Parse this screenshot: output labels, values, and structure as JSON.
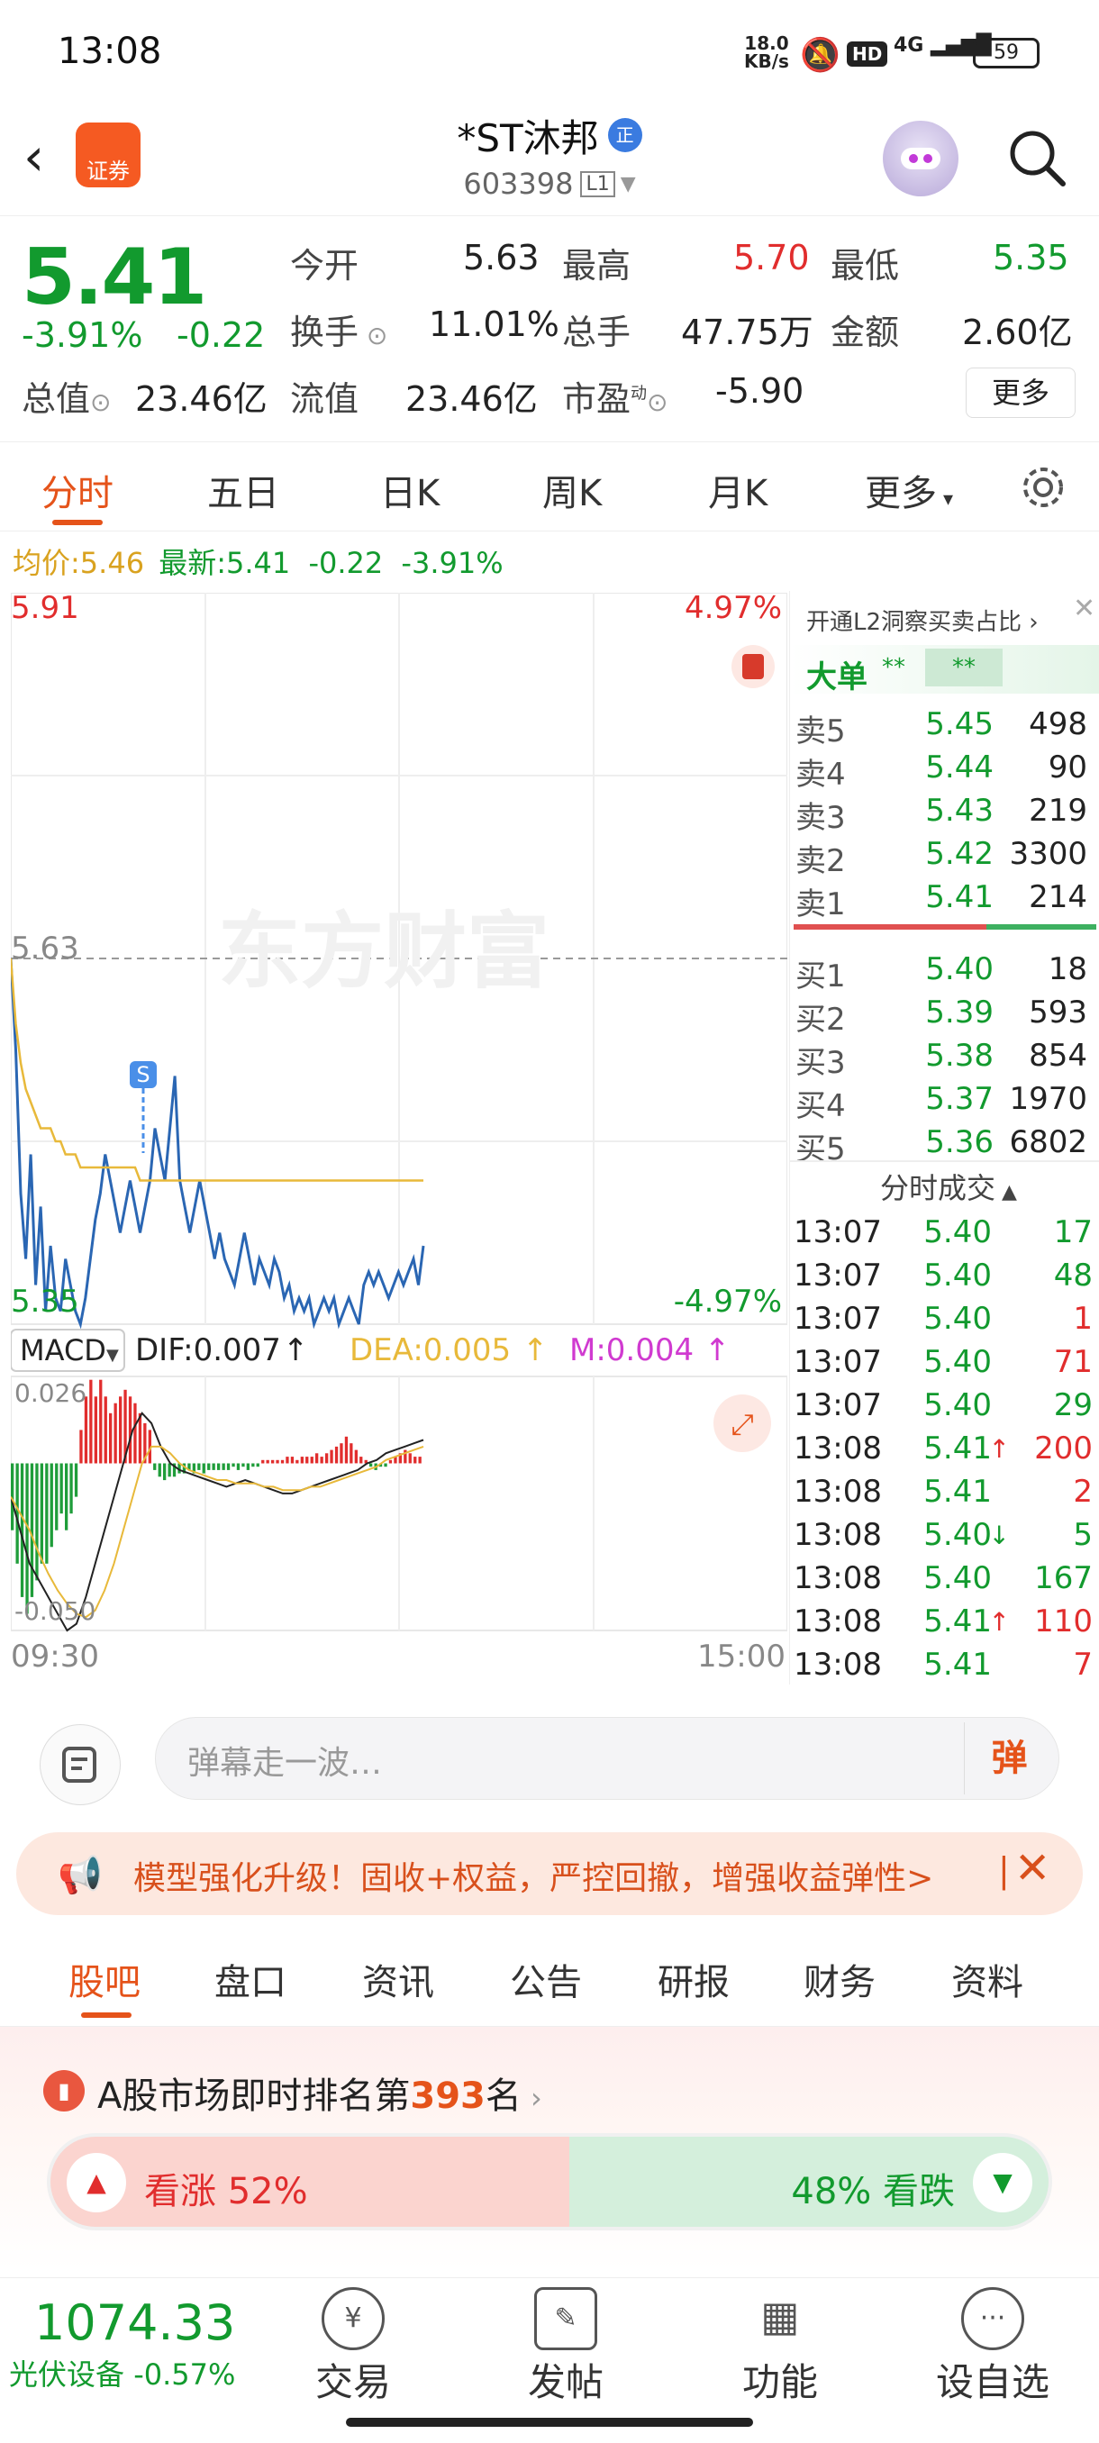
{
  "status": {
    "time": "13:08",
    "net_speed_value": "18.0",
    "net_speed_unit": "KB/s",
    "hd": "HD",
    "network": "4G",
    "battery": "59"
  },
  "header": {
    "logo_text": "证券",
    "stock_name": "*ST沐邦",
    "badge": "正",
    "code": "603398",
    "level": "L1"
  },
  "quote": {
    "price": "5.41",
    "change_pct": "-3.91%",
    "change": "-0.22",
    "open_label": "今开",
    "open": "5.63",
    "high_label": "最高",
    "high": "5.70",
    "low_label": "最低",
    "low": "5.35",
    "turnover_label": "换手",
    "turnover": "11.01%",
    "volume_label": "总手",
    "volume": "47.75万",
    "amount_label": "金额",
    "amount": "2.60亿",
    "mcap_label": "总值",
    "mcap": "23.46亿",
    "float_label": "流值",
    "float": "23.46亿",
    "pe_label": "市盈",
    "pe_sup": "动",
    "pe": "-5.90",
    "more": "更多"
  },
  "chart_tabs": [
    "分时",
    "五日",
    "日K",
    "周K",
    "月K",
    "更多"
  ],
  "avg_line": {
    "avg_label": "均价:",
    "avg": "5.46",
    "latest_label": "最新:",
    "latest": "5.41",
    "chg": "-0.22",
    "pct": "-3.91%"
  },
  "chart": {
    "price_top": "5.91",
    "pct_top": "4.97%",
    "price_mid": "5.63",
    "price_bottom": "5.35",
    "pct_bottom": "-4.97%",
    "watermark": "东方财富",
    "s_marker": "S",
    "macd_label": "MACD",
    "dif": "DIF:0.007",
    "dea": "DEA:0.005",
    "m": "M:0.004",
    "macd_top": "0.026",
    "macd_bottom": "-0.050",
    "time_start": "09:30",
    "time_end": "15:00"
  },
  "chart_data": {
    "type": "line",
    "ylim": [
      5.35,
      5.91
    ],
    "x_range": [
      "09:30",
      "15:00"
    ],
    "series": [],
    "price_points": [
      5.63,
      5.56,
      5.45,
      5.4,
      5.48,
      5.38,
      5.44,
      5.36,
      5.41,
      5.37,
      5.36,
      5.4,
      5.38,
      5.36,
      5.35,
      5.37,
      5.4,
      5.43,
      5.45,
      5.48,
      5.46,
      5.44,
      5.42,
      5.44,
      5.46,
      5.44,
      5.42,
      5.44,
      5.46,
      5.5,
      5.48,
      5.46,
      5.5,
      5.54,
      5.46,
      5.44,
      5.42,
      5.44,
      5.46,
      5.44,
      5.42,
      5.4,
      5.42,
      5.4,
      5.39,
      5.38,
      5.4,
      5.42,
      5.4,
      5.38,
      5.4,
      5.39,
      5.38,
      5.4,
      5.39,
      5.37,
      5.38,
      5.36,
      5.37,
      5.36,
      5.37,
      5.35,
      5.36,
      5.37,
      5.36,
      5.37,
      5.35,
      5.36,
      5.37,
      5.36,
      5.35,
      5.38,
      5.39,
      5.38,
      5.39,
      5.38,
      5.37,
      5.38,
      5.39,
      5.38,
      5.39,
      5.4,
      5.38,
      5.41
    ],
    "avg_points": [
      5.63,
      5.58,
      5.55,
      5.53,
      5.52,
      5.51,
      5.5,
      5.5,
      5.5,
      5.49,
      5.49,
      5.48,
      5.48,
      5.48,
      5.47,
      5.47,
      5.47,
      5.47,
      5.47,
      5.47,
      5.47,
      5.47,
      5.47,
      5.47,
      5.47,
      5.47,
      5.46,
      5.46,
      5.46,
      5.46,
      5.46,
      5.46,
      5.46,
      5.46,
      5.46,
      5.46,
      5.46,
      5.46,
      5.46,
      5.46,
      5.46,
      5.46,
      5.46,
      5.46,
      5.46,
      5.46,
      5.46,
      5.46,
      5.46,
      5.46,
      5.46,
      5.46,
      5.46,
      5.46,
      5.46,
      5.46,
      5.46,
      5.46,
      5.46,
      5.46,
      5.46,
      5.46,
      5.46,
      5.46,
      5.46,
      5.46,
      5.46,
      5.46,
      5.46,
      5.46,
      5.46,
      5.46,
      5.46,
      5.46,
      5.46,
      5.46,
      5.46,
      5.46,
      5.46,
      5.46,
      5.46,
      5.46,
      5.46,
      5.46
    ],
    "macd_ylim": [
      -0.05,
      0.026
    ],
    "macd_hist": [
      -0.02,
      -0.03,
      -0.04,
      -0.045,
      -0.04,
      -0.035,
      -0.03,
      -0.03,
      -0.025,
      -0.02,
      -0.015,
      -0.02,
      -0.015,
      -0.01,
      0.01,
      0.02,
      0.025,
      0.02,
      0.025,
      0.02,
      0.015,
      0.018,
      0.02,
      0.022,
      0.02,
      0.018,
      0.015,
      0.012,
      0.01,
      -0.002,
      -0.004,
      -0.005,
      -0.004,
      -0.004,
      -0.003,
      -0.003,
      -0.002,
      -0.003,
      -0.002,
      -0.003,
      -0.002,
      -0.002,
      -0.002,
      -0.002,
      -0.002,
      -0.001,
      -0.002,
      -0.001,
      -0.002,
      -0.001,
      -0.001,
      0.001,
      0.001,
      0.001,
      0.001,
      0.001,
      0.002,
      0.002,
      0.001,
      0.002,
      0.002,
      0.002,
      0.003,
      0.002,
      0.003,
      0.004,
      0.005,
      0.006,
      0.008,
      0.006,
      0.004,
      0.002,
      0.001,
      -0.001,
      -0.002,
      -0.001,
      -0.001,
      0.001,
      0.002,
      0.003,
      0.004,
      0.003,
      0.002,
      0.002
    ],
    "dif_points": [
      -0.01,
      -0.02,
      -0.03,
      -0.035,
      -0.04,
      -0.045,
      -0.05,
      -0.048,
      -0.04,
      -0.03,
      -0.02,
      -0.01,
      0.0,
      0.01,
      0.015,
      0.012,
      0.005,
      0.0,
      -0.002,
      -0.003,
      -0.004,
      -0.005,
      -0.006,
      -0.007,
      -0.006,
      -0.005,
      -0.006,
      -0.007,
      -0.008,
      -0.009,
      -0.009,
      -0.008,
      -0.007,
      -0.006,
      -0.005,
      -0.004,
      -0.003,
      -0.002,
      0.0,
      0.001,
      0.003,
      0.004,
      0.005,
      0.006,
      0.007
    ],
    "dea_points": [
      -0.01,
      -0.015,
      -0.02,
      -0.027,
      -0.033,
      -0.038,
      -0.042,
      -0.045,
      -0.046,
      -0.044,
      -0.038,
      -0.03,
      -0.02,
      -0.01,
      0.0,
      0.005,
      0.005,
      0.003,
      0.0,
      -0.002,
      -0.003,
      -0.004,
      -0.005,
      -0.005,
      -0.006,
      -0.006,
      -0.006,
      -0.007,
      -0.007,
      -0.008,
      -0.008,
      -0.008,
      -0.007,
      -0.007,
      -0.006,
      -0.005,
      -0.004,
      -0.003,
      -0.002,
      -0.001,
      0.001,
      0.002,
      0.003,
      0.004,
      0.005
    ]
  },
  "orderbook": {
    "promo": "开通L2洞察买卖占比",
    "big_order": "大单",
    "stars": "**",
    "sells": [
      {
        "label": "卖5",
        "price": "5.45",
        "vol": "498"
      },
      {
        "label": "卖4",
        "price": "5.44",
        "vol": "90"
      },
      {
        "label": "卖3",
        "price": "5.43",
        "vol": "219"
      },
      {
        "label": "卖2",
        "price": "5.42",
        "vol": "3300"
      },
      {
        "label": "卖1",
        "price": "5.41",
        "vol": "214"
      }
    ],
    "buys": [
      {
        "label": "买1",
        "price": "5.40",
        "vol": "18"
      },
      {
        "label": "买2",
        "price": "5.39",
        "vol": "593"
      },
      {
        "label": "买3",
        "price": "5.38",
        "vol": "854"
      },
      {
        "label": "买4",
        "price": "5.37",
        "vol": "1970"
      },
      {
        "label": "买5",
        "price": "5.36",
        "vol": "6802"
      }
    ],
    "ticks_title": "分时成交",
    "ticks": [
      {
        "time": "13:07",
        "price": "5.40",
        "arrow": "",
        "vol": "17",
        "dir": "green"
      },
      {
        "time": "13:07",
        "price": "5.40",
        "arrow": "",
        "vol": "48",
        "dir": "green"
      },
      {
        "time": "13:07",
        "price": "5.40",
        "arrow": "",
        "vol": "1",
        "dir": "red"
      },
      {
        "time": "13:07",
        "price": "5.40",
        "arrow": "",
        "vol": "71",
        "dir": "red"
      },
      {
        "time": "13:07",
        "price": "5.40",
        "arrow": "",
        "vol": "29",
        "dir": "green"
      },
      {
        "time": "13:08",
        "price": "5.41",
        "arrow": "↑",
        "vol": "200",
        "dir": "red"
      },
      {
        "time": "13:08",
        "price": "5.41",
        "arrow": "",
        "vol": "2",
        "dir": "red"
      },
      {
        "time": "13:08",
        "price": "5.40",
        "arrow": "↓",
        "vol": "5",
        "dir": "green"
      },
      {
        "time": "13:08",
        "price": "5.40",
        "arrow": "",
        "vol": "167",
        "dir": "green"
      },
      {
        "time": "13:08",
        "price": "5.41",
        "arrow": "↑",
        "vol": "110",
        "dir": "red"
      },
      {
        "time": "13:08",
        "price": "5.41",
        "arrow": "",
        "vol": "7",
        "dir": "red"
      }
    ]
  },
  "danmu": {
    "placeholder": "弹幕走一波…",
    "button": "弹"
  },
  "promo": {
    "text": "模型强化升级！固收+权益，严控回撤，增强收益弹性>",
    "sep": "|"
  },
  "bottom_tabs": [
    "股吧",
    "盘口",
    "资讯",
    "公告",
    "研报",
    "财务",
    "资料"
  ],
  "rank": {
    "prefix": "A股市场即时排名第",
    "num": "393",
    "suffix": "名",
    "up_label": "看涨",
    "up_pct": "52%",
    "down_pct": "48%",
    "down_label": "看跌",
    "up_value": 52,
    "down_value": 48
  },
  "bottom_nav": {
    "index_value": "1074.33",
    "index_name": "光伏设备",
    "index_chg": "-0.57%",
    "items": [
      {
        "label": "交易",
        "icon": "¥"
      },
      {
        "label": "发帖",
        "icon": "✎"
      },
      {
        "label": "功能",
        "icon": "▦"
      },
      {
        "label": "设自选",
        "icon": "···"
      }
    ]
  },
  "colors": {
    "accent": "#e5531a",
    "up": "#e12d2d",
    "down": "#129a2e",
    "price_line": "#2a66b3",
    "avg_line": "#e8b93a"
  }
}
